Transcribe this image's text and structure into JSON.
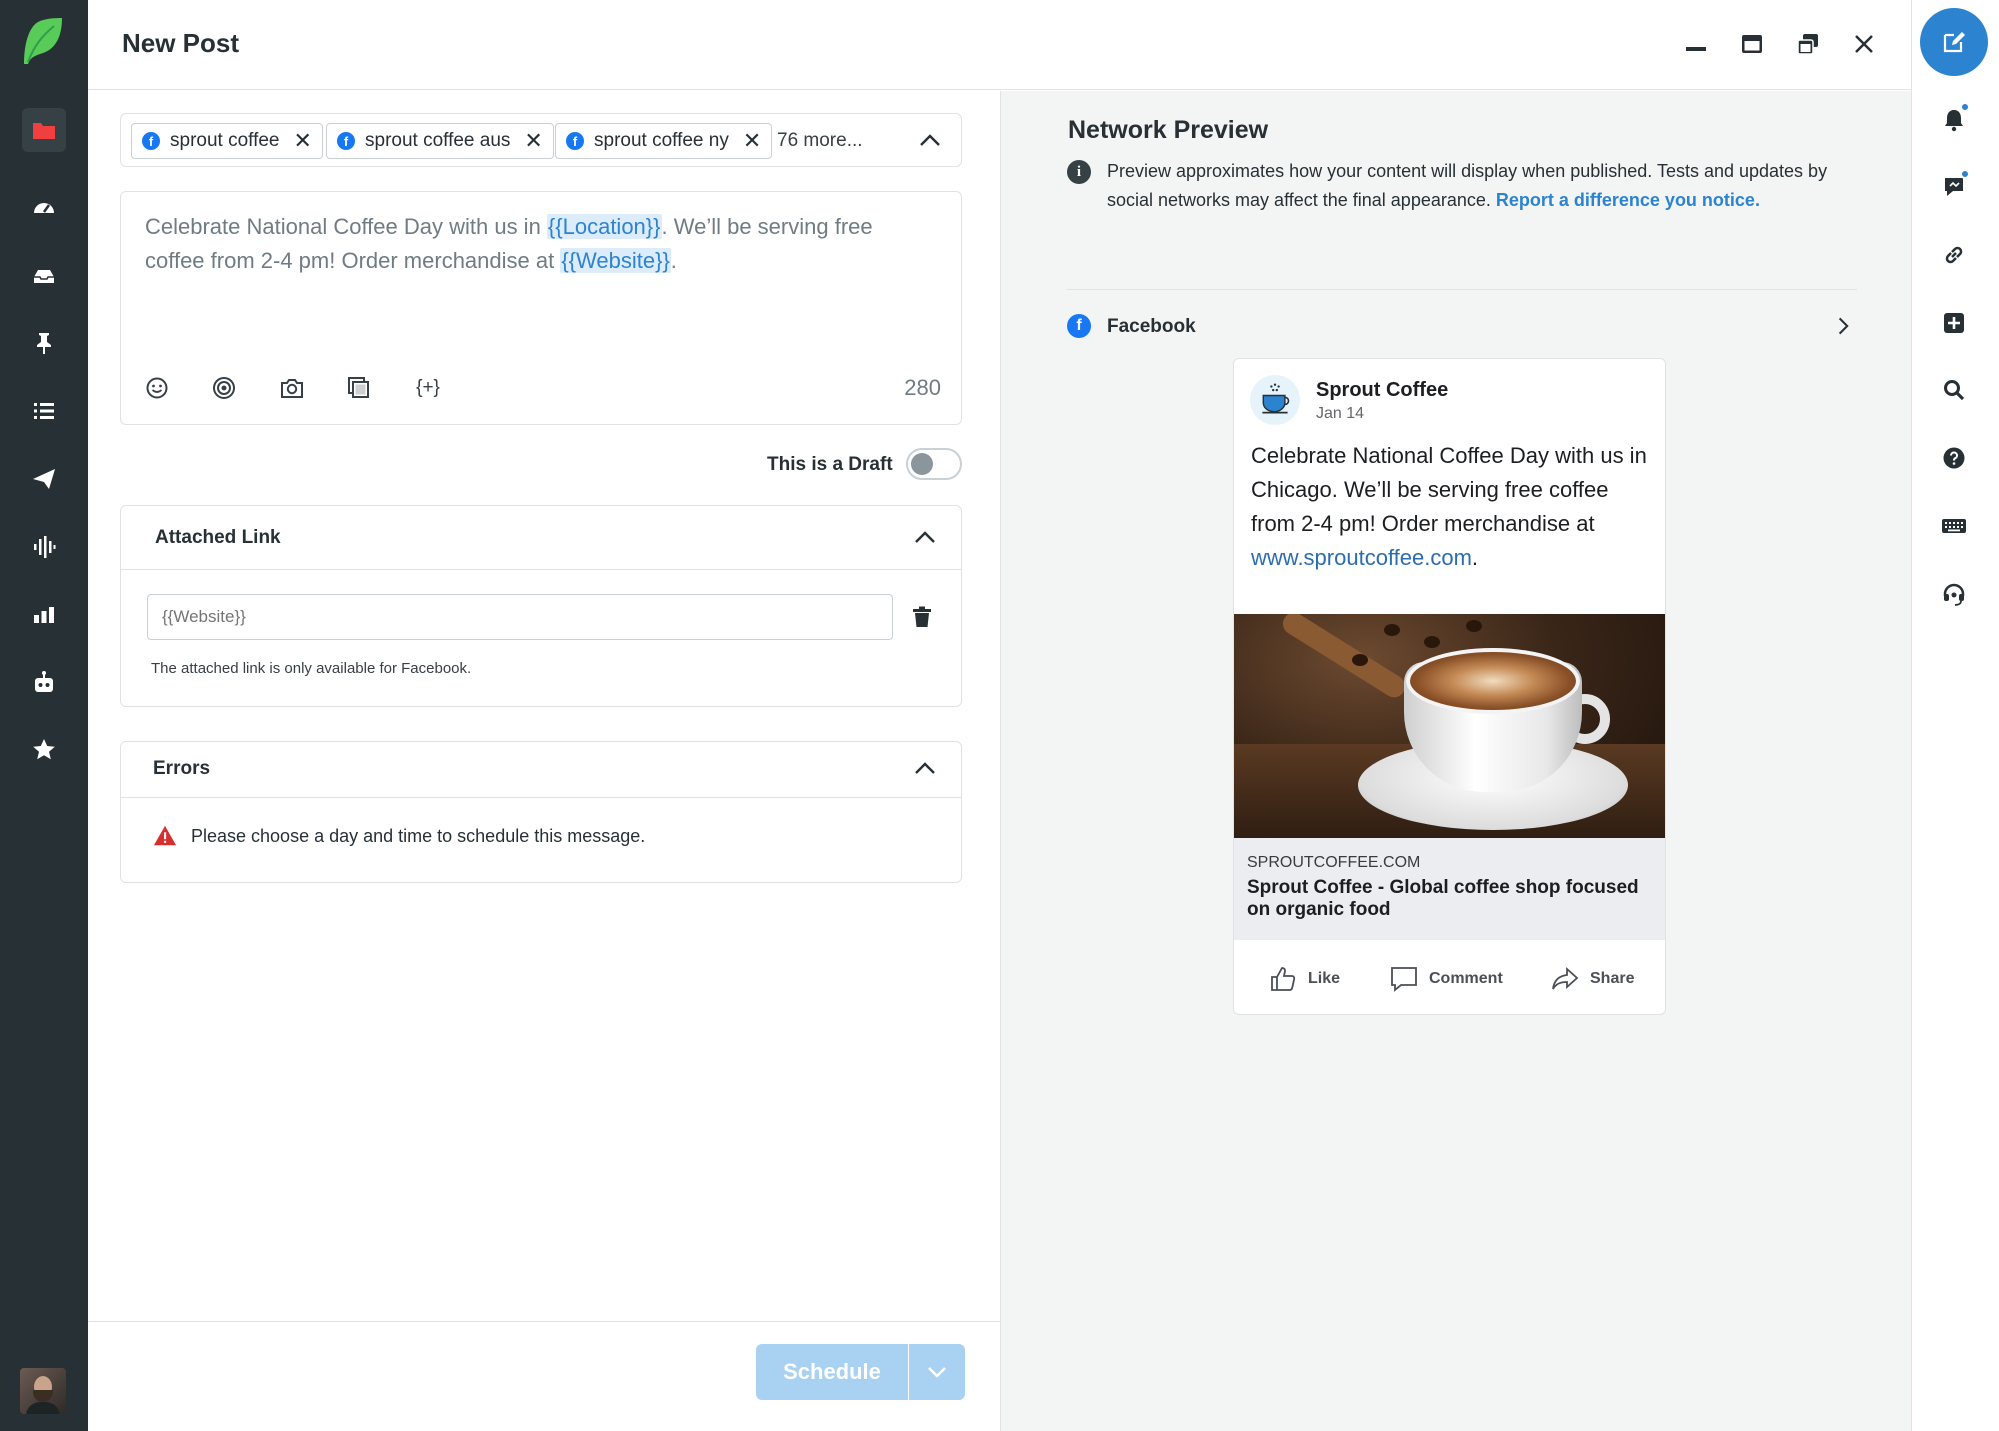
{
  "header": {
    "title": "New Post"
  },
  "profiles": {
    "chips": [
      {
        "label": "sprout coffee"
      },
      {
        "label": "sprout coffee aus"
      },
      {
        "label": "sprout coffee ny"
      }
    ],
    "more_label": "76 more..."
  },
  "editor": {
    "text_before_location": "Celebrate National Coffee Day with us in ",
    "location_var": "{{Location}}",
    "text_middle": ". We’ll be serving free coffee from 2-4 pm! Order merchandise at ",
    "website_var": "{{Website}}",
    "text_end": ".",
    "char_count": "280",
    "tools": [
      "smile-icon",
      "target-icon",
      "camera-icon",
      "gallery-icon",
      "variable-icon"
    ],
    "variable_tool_label": "{+}"
  },
  "draft": {
    "label": "This is a Draft",
    "enabled": false
  },
  "attached_link": {
    "title": "Attached Link",
    "placeholder": "{{Website}}",
    "note": "The attached link is only available for Facebook."
  },
  "errors": {
    "title": "Errors",
    "message": "Please choose a day and time to schedule this message."
  },
  "footer": {
    "schedule_label": "Schedule"
  },
  "preview": {
    "title": "Network Preview",
    "description": "Preview approximates how your content will display when published. Tests and updates by social networks may affect the final appearance. ",
    "report_link": "Report a difference you notice.",
    "network_label": "Facebook",
    "post": {
      "page_name": "Sprout Coffee",
      "date": "Jan 14",
      "text": "Celebrate National Coffee Day with us in Chicago. We’ll be serving free coffee from 2-4 pm! Order merchandise at ",
      "link_text": "www.sproutcoffee.com",
      "text_end": ".",
      "link_domain": "SPROUTCOFFEE.COM",
      "link_headline": "Sprout Coffee - Global coffee shop focused on organic food",
      "actions": {
        "like": "Like",
        "comment": "Comment",
        "share": "Share"
      }
    }
  },
  "colors": {
    "nav_bg": "#273135",
    "accent": "#2c83d0",
    "facebook": "#1877f2",
    "schedule_disabled": "#a8d1f2",
    "error": "#d62f2f",
    "brand_green": "#59cb59"
  }
}
